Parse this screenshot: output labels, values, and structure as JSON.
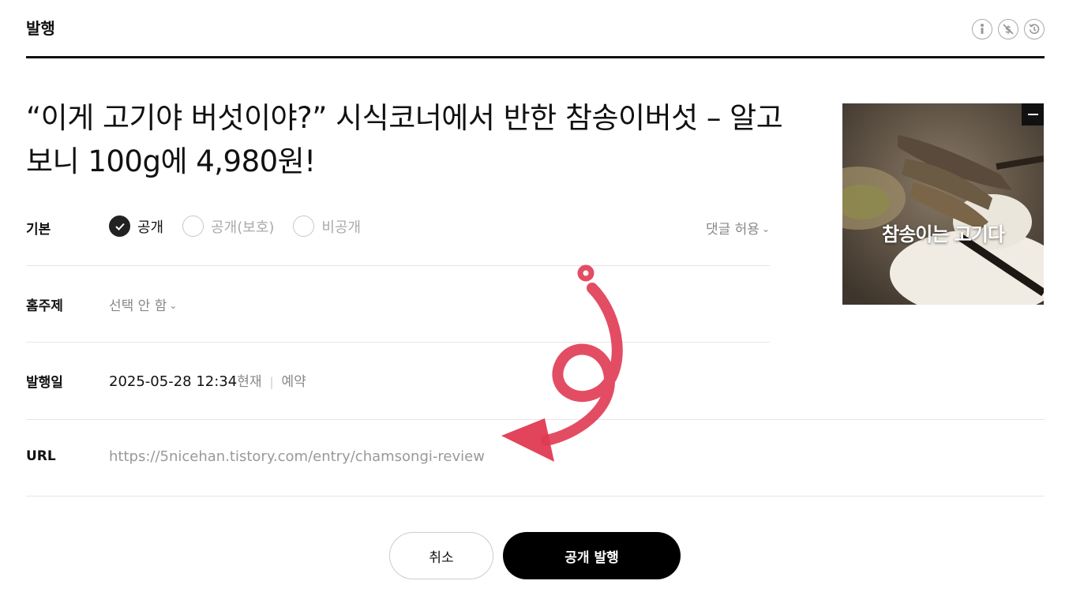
{
  "header": {
    "title": "발행",
    "icons": [
      "accessibility-icon",
      "no-money-icon",
      "history-icon"
    ]
  },
  "post": {
    "title": "“이게 고기야 버섯이야?” 시식코너에서 반한 참송이버섯 – 알고 보니 100g에 4,980원!"
  },
  "thumbnail": {
    "caption": "참송이는 고기다"
  },
  "basic": {
    "label": "기본",
    "options": [
      {
        "label": "공개",
        "checked": true
      },
      {
        "label": "공개(보호)",
        "checked": false
      },
      {
        "label": "비공개",
        "checked": false
      }
    ],
    "comment_option": "댓글 허용"
  },
  "home_topic": {
    "label": "홈주제",
    "value": "선택 안 함"
  },
  "publish_date": {
    "label": "발행일",
    "value": "2025-05-28 12:34",
    "now_label": "현재",
    "reserve_label": "예약"
  },
  "url": {
    "label": "URL",
    "value": "https://5nicehan.tistory.com/entry/chamsongi-review"
  },
  "buttons": {
    "cancel": "취소",
    "publish": "공개 발행"
  },
  "colors": {
    "accent": "#000000",
    "annotation": "#e03a52"
  }
}
